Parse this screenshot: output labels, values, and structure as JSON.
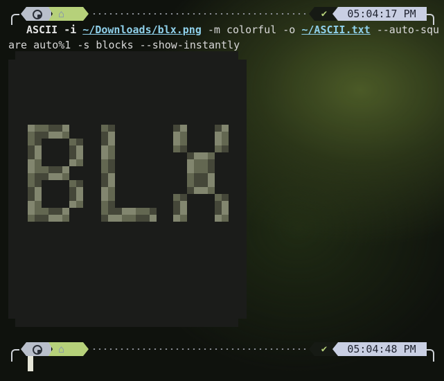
{
  "prompt_top": {
    "os_icon": "os-logo-icon",
    "home_icon": "home-icon",
    "status_icon": "check-icon",
    "status_glyph": "✔",
    "time": "05:04:17 PM"
  },
  "command": {
    "program": "ASCII",
    "flag_i": "-i",
    "input_path": "~/Downloads/blx.png",
    "flag_m": "-m colorful -o",
    "output_path": "~/ASCII.txt",
    "rest": "--auto-square auto%1 -s blocks --show-instantly"
  },
  "output": {
    "art_description_icon": "ascii-blocks-image",
    "art_text": "BLX",
    "colors": {
      "frame": "#1b1c1a",
      "letters_light": "#8e9279",
      "letters_mid": "#6c7058",
      "letters_dark": "#4a4d3d"
    }
  },
  "prompt_bottom": {
    "os_icon": "os-logo-icon",
    "home_icon": "home-icon",
    "status_icon": "check-icon",
    "status_glyph": "✔",
    "time": "05:04:48 PM"
  },
  "colors": {
    "os_segment": "#b9bfcb",
    "home_segment": "#b6d17a",
    "time_segment": "#c9cfe3",
    "path": "#8fd0ea",
    "background": "#0f120d",
    "glow": "#4b5a27"
  }
}
